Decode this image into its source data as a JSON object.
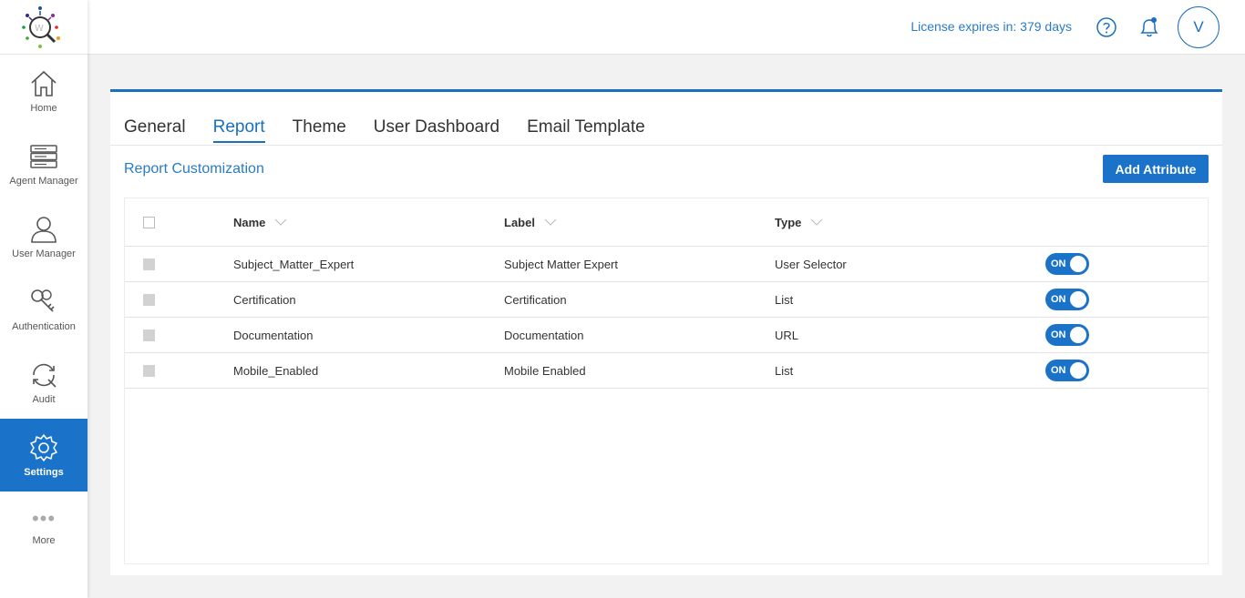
{
  "sidebar": {
    "items": [
      {
        "label": "Home",
        "icon": "home-icon"
      },
      {
        "label": "Agent Manager",
        "icon": "server-icon"
      },
      {
        "label": "User Manager",
        "icon": "user-icon"
      },
      {
        "label": "Authentication",
        "icon": "keys-icon"
      },
      {
        "label": "Audit",
        "icon": "audit-refresh-icon"
      },
      {
        "label": "Settings",
        "icon": "gear-icon",
        "active": true
      },
      {
        "label": "More",
        "icon": "more-dots-icon"
      }
    ]
  },
  "header": {
    "license_text": "License expires in: 379 days",
    "avatar_initial": "V"
  },
  "tabs": [
    {
      "label": "General"
    },
    {
      "label": "Report",
      "active": true
    },
    {
      "label": "Theme"
    },
    {
      "label": "User Dashboard"
    },
    {
      "label": "Email Template"
    }
  ],
  "section": {
    "title": "Report Customization",
    "add_button": "Add Attribute"
  },
  "table": {
    "columns": [
      "Name",
      "Label",
      "Type"
    ],
    "rows": [
      {
        "name": "Subject_Matter_Expert",
        "label": "Subject Matter Expert",
        "type": "User Selector",
        "toggle": "ON"
      },
      {
        "name": "Certification",
        "label": "Certification",
        "type": "List",
        "toggle": "ON"
      },
      {
        "name": "Documentation",
        "label": "Documentation",
        "type": "URL",
        "toggle": "ON"
      },
      {
        "name": "Mobile_Enabled",
        "label": "Mobile Enabled",
        "type": "List",
        "toggle": "ON"
      }
    ]
  },
  "colors": {
    "accent": "#1a73c9",
    "link": "#2a7bc6",
    "background": "#f2f2f2"
  }
}
